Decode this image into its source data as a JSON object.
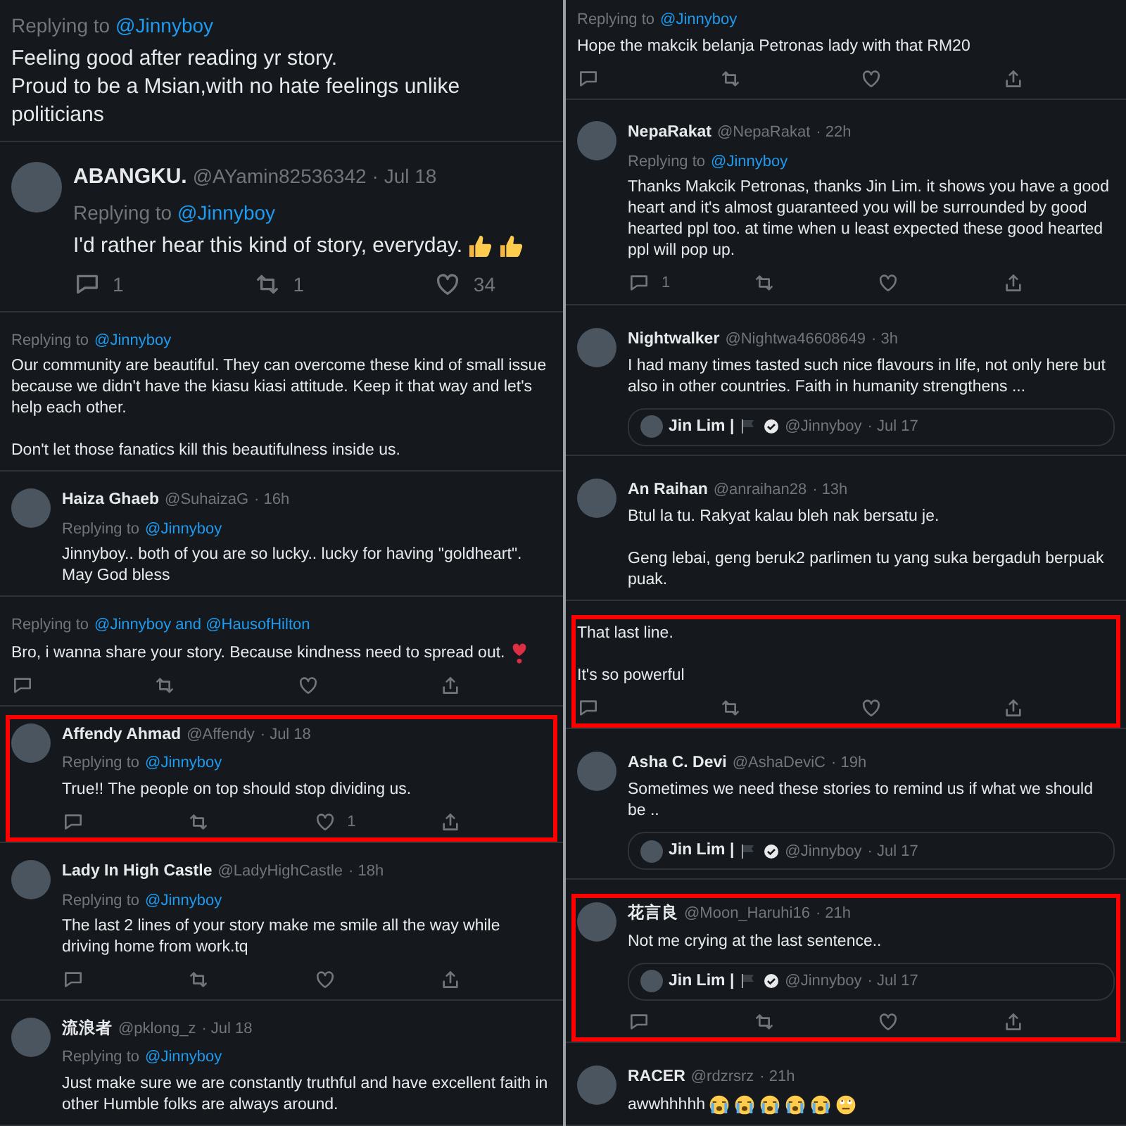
{
  "columns": [
    {
      "snippets": [
        {
          "kind": "large",
          "highlighted": false,
          "replying": {
            "label": "Replying to",
            "to": "@Jinnyboy"
          },
          "text": "Feeling good after reading yr story.\nProud to be a Msian,with no hate feelings unlike politicians"
        },
        {
          "kind": "large",
          "highlighted": false,
          "name": "ABANGKU.",
          "handle": "@AYamin82536342",
          "time": "· Jul 18",
          "replying": {
            "label": "Replying to",
            "to": "@Jinnyboy"
          },
          "text": "I'd rather hear this kind of story, everyday.",
          "emojis": [
            {
              "kind": "thumbs-up"
            },
            {
              "kind": "thumbs-up"
            }
          ],
          "actions": [
            {
              "kind": "reply",
              "count": "1"
            },
            {
              "kind": "retweet",
              "count": "1"
            },
            {
              "kind": "like",
              "count": "34"
            }
          ]
        },
        {
          "kind": "normal",
          "highlighted": false,
          "replying": {
            "label": "Replying to",
            "to": "@Jinnyboy"
          },
          "text": "Our community are beautiful. They can overcome these kind of small issue because we didn't have the kiasu kiasi attitude. Keep it that way and let's help each other.\n\nDon't let those fanatics kill this beautifulness inside us."
        },
        {
          "kind": "normal",
          "highlighted": false,
          "name": "Haiza Ghaeb",
          "handle": "@SuhaizaG",
          "time": "· 16h",
          "replying": {
            "label": "Replying to",
            "to": "@Jinnyboy"
          },
          "text": "Jinnyboy.. both of you are so lucky.. lucky for having \"goldheart\". May God bless"
        },
        {
          "kind": "normal",
          "highlighted": false,
          "replying": {
            "label": "Replying to",
            "to": "@Jinnyboy and @HausofHilton"
          },
          "text": "Bro, i wanna share your story. Because kindness need to spread out.",
          "emojis": [
            {
              "kind": "heart"
            }
          ],
          "actions": [
            {
              "kind": "reply"
            },
            {
              "kind": "retweet"
            },
            {
              "kind": "like"
            },
            {
              "kind": "share"
            }
          ]
        },
        {
          "kind": "normal",
          "highlighted": true,
          "name": "Affendy Ahmad",
          "handle": "@Affendy",
          "time": "· Jul 18",
          "replying": {
            "label": "Replying to",
            "to": "@Jinnyboy"
          },
          "text": "True!! The people on top should stop dividing us.",
          "actions": [
            {
              "kind": "reply"
            },
            {
              "kind": "retweet"
            },
            {
              "kind": "like",
              "count": "1"
            },
            {
              "kind": "share"
            }
          ]
        },
        {
          "kind": "normal",
          "highlighted": false,
          "name": "Lady In High Castle",
          "handle": "@LadyHighCastle",
          "time": "· 18h",
          "replying": {
            "label": "Replying to",
            "to": "@Jinnyboy"
          },
          "text": "The last 2 lines of your story make me smile all the way while driving home from work.tq",
          "actions": [
            {
              "kind": "reply"
            },
            {
              "kind": "retweet"
            },
            {
              "kind": "like"
            },
            {
              "kind": "share"
            }
          ]
        },
        {
          "kind": "normal",
          "highlighted": false,
          "name": "流浪者",
          "handle": "@pklong_z",
          "time": "· Jul 18",
          "replying": {
            "label": "Replying to",
            "to": "@Jinnyboy"
          },
          "text": "Just make sure we are constantly truthful and have excellent faith in other Humble folks are always around."
        }
      ]
    },
    {
      "snippets": [
        {
          "kind": "normal",
          "highlighted": false,
          "replying": {
            "label": "Replying to",
            "to": "@Jinnyboy"
          },
          "text": "Hope the makcik belanja Petronas lady with that RM20",
          "actions": [
            {
              "kind": "reply"
            },
            {
              "kind": "retweet"
            },
            {
              "kind": "like"
            },
            {
              "kind": "share"
            }
          ]
        },
        {
          "kind": "normal",
          "highlighted": false,
          "name": "NepaRakat",
          "handle": "@NepaRakat",
          "time": "· 22h",
          "replying": {
            "label": "Replying to",
            "to": "@Jinnyboy"
          },
          "text": "Thanks Makcik Petronas, thanks Jin Lim. it shows you have a good heart and it's almost guaranteed you will be surrounded by good hearted ppl too. at time when u least expected these good hearted ppl will pop up.",
          "actions": [
            {
              "kind": "reply",
              "count": "1"
            },
            {
              "kind": "retweet"
            },
            {
              "kind": "like"
            },
            {
              "kind": "share"
            }
          ]
        },
        {
          "kind": "normal",
          "highlighted": false,
          "name": "Nightwalker",
          "handle": "@Nightwa46608649",
          "time": "· 3h",
          "text": "I had many times tasted such nice flavours in life, not only here but also in other countries. Faith in humanity strengthens ...",
          "quote": {
            "name": "Jin Lim |",
            "handle": "@Jinnyboy",
            "time": "· Jul 17",
            "verified": true
          }
        },
        {
          "kind": "normal",
          "highlighted": false,
          "name": "An Raihan",
          "handle": "@anraihan28",
          "time": "· 13h",
          "text": "Btul la tu.  Rakyat kalau bleh nak bersatu je.\n\nGeng lebai,  geng beruk2 parlimen tu yang suka bergaduh berpuak puak."
        },
        {
          "kind": "normal",
          "highlighted": true,
          "text": "That last line.\n\nIt's so powerful",
          "actions": [
            {
              "kind": "reply"
            },
            {
              "kind": "retweet"
            },
            {
              "kind": "like"
            },
            {
              "kind": "share"
            }
          ]
        },
        {
          "kind": "normal",
          "highlighted": false,
          "name": "Asha C. Devi",
          "handle": "@AshaDeviC",
          "time": "· 19h",
          "text": "Sometimes we need these stories to remind us if what we should be ..",
          "quote": {
            "name": "Jin Lim |",
            "handle": "@Jinnyboy",
            "time": "· Jul 17",
            "verified": true
          }
        },
        {
          "kind": "normal",
          "highlighted": true,
          "name": "花言良",
          "handle": "@Moon_Haruhi16",
          "time": "· 21h",
          "text": "Not me crying at the last sentence..",
          "quote": {
            "name": "Jin Lim |",
            "handle": "@Jinnyboy",
            "time": "· Jul 17",
            "verified": true
          },
          "actions": [
            {
              "kind": "reply"
            },
            {
              "kind": "retweet"
            },
            {
              "kind": "like"
            },
            {
              "kind": "share"
            }
          ]
        },
        {
          "kind": "normal",
          "highlighted": false,
          "name": "RACER",
          "handle": "@rdzrsrz",
          "time": "· 21h",
          "text": "awwhhhhh",
          "emojis": [
            {
              "kind": "crying"
            },
            {
              "kind": "crying"
            },
            {
              "kind": "crying"
            },
            {
              "kind": "crying"
            },
            {
              "kind": "crying"
            },
            {
              "kind": "eye-roll"
            }
          ]
        }
      ]
    }
  ]
}
